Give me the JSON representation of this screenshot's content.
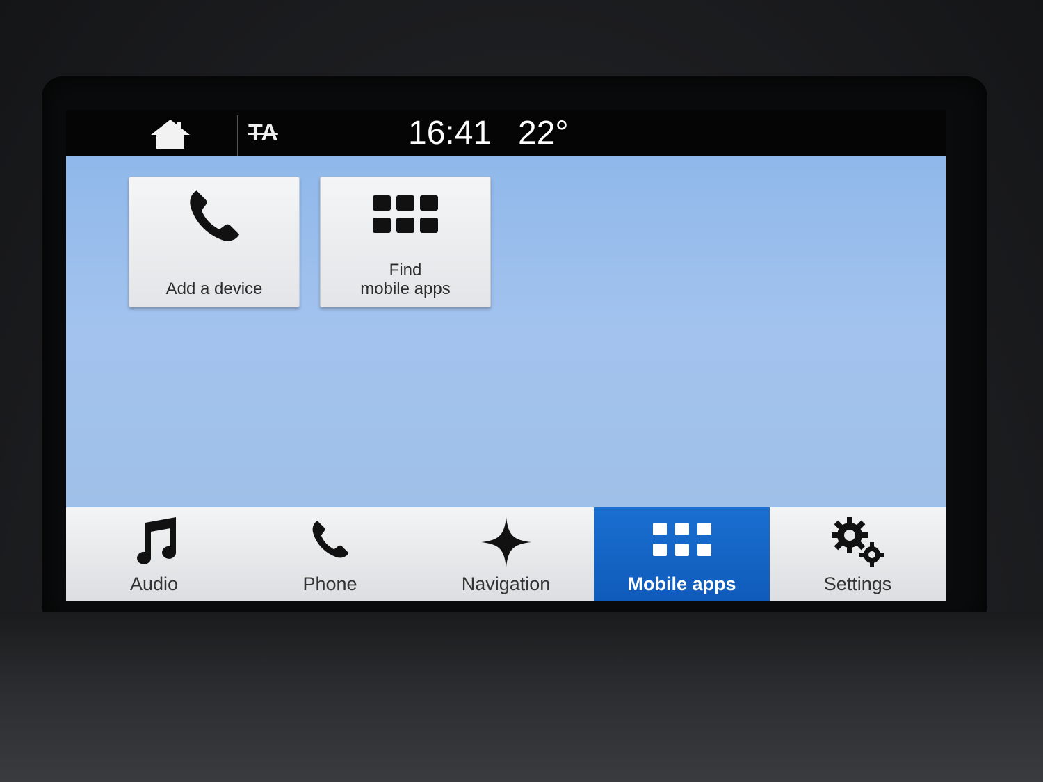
{
  "statusbar": {
    "ta_label": "TA",
    "time": "16:41",
    "temperature": "22°"
  },
  "tiles": [
    {
      "label": "Add a device",
      "icon": "phone-icon"
    },
    {
      "label_line1": "Find",
      "label_line2": "mobile apps",
      "icon": "apps-grid-icon"
    }
  ],
  "navbar": {
    "items": [
      {
        "label": "Audio",
        "icon": "music-note-icon"
      },
      {
        "label": "Phone",
        "icon": "phone-icon"
      },
      {
        "label": "Navigation",
        "icon": "compass-star-icon"
      },
      {
        "label": "Mobile apps",
        "icon": "apps-grid-icon",
        "active": true
      },
      {
        "label": "Settings",
        "icon": "gears-icon"
      }
    ]
  },
  "colors": {
    "accent_blue": "#1565c8",
    "content_bg": "#9fc0e8",
    "statusbar_bg": "#050505"
  }
}
